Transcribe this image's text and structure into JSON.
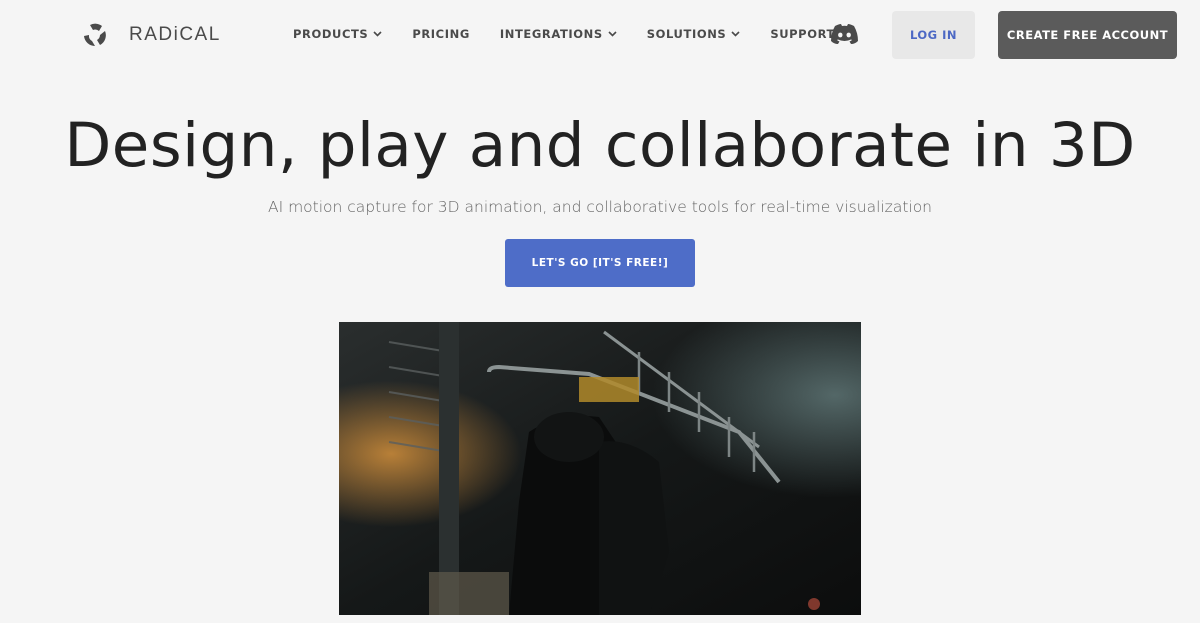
{
  "brand": {
    "name": "RADiCAL"
  },
  "nav": {
    "items": [
      {
        "label": "PRODUCTS",
        "has_dropdown": true
      },
      {
        "label": "PRICING",
        "has_dropdown": false
      },
      {
        "label": "INTEGRATIONS",
        "has_dropdown": true
      },
      {
        "label": "SOLUTIONS",
        "has_dropdown": true
      },
      {
        "label": "SUPPORT",
        "has_dropdown": true
      }
    ],
    "discord_icon": "discord-icon",
    "login_label": "LOG IN",
    "create_account_label": "CREATE FREE ACCOUNT"
  },
  "hero": {
    "title": "Design, play and collaborate in 3D",
    "subtitle": "AI motion capture for 3D animation, and collaborative tools for real-time visualization",
    "cta_label": "LET'S GO [IT'S FREE!]",
    "media": "hero-video-scene"
  },
  "colors": {
    "background": "#f5f5f5",
    "accent_blue": "#4e6dc8",
    "login_text": "#4c68c4",
    "dark_button": "#5b5b5b"
  }
}
